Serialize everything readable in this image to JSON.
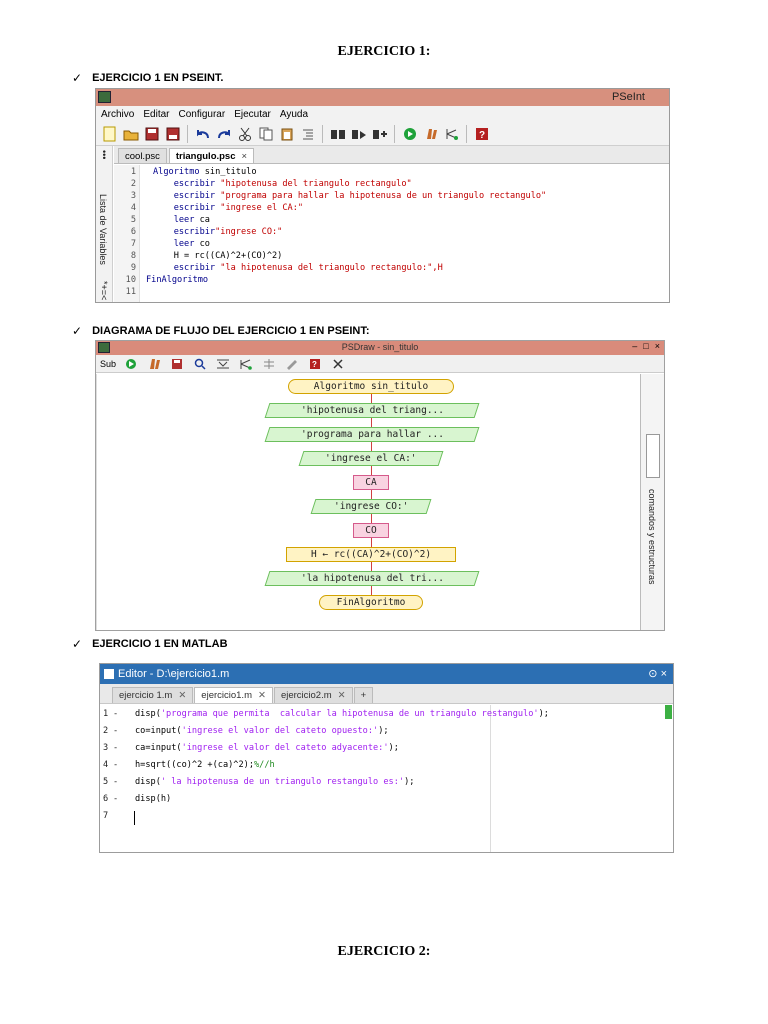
{
  "headings": {
    "ex1": "EJERCICIO 1:",
    "ex2": "EJERCICIO 2:"
  },
  "bullets": {
    "check_symbol": "✓",
    "b1": "EJERCICIO 1 EN PSEINT.",
    "b2": "DIAGRAMA DE FLUJO DEL EJERCICIO 1 EN PSEINT:",
    "b3": "EJERCICIO 1 EN MATLAB"
  },
  "pseint": {
    "title": "PSeInt",
    "menu": [
      "Archivo",
      "Editar",
      "Configurar",
      "Ejecutar",
      "Ayuda"
    ],
    "tabs": [
      {
        "label": "cool.psc",
        "active": false
      },
      {
        "label": "triangulo.psc",
        "active": true,
        "close": "×"
      }
    ],
    "side_label": "Lista de Variables",
    "side_ops_top": "•••",
    "side_ops_bottom": "*+=<",
    "lines": [
      {
        "n": "1",
        "kw": "Algoritmo",
        "rest": " sin_titulo"
      },
      {
        "n": "2",
        "kw": "    escribir",
        "rest": " \"hipotenusa del triangulo rectangulo\""
      },
      {
        "n": "3",
        "kw": "    escribir",
        "rest": " \"programa para hallar la hipotenusa de un triangulo rectangulo\""
      },
      {
        "n": "4",
        "kw": "    escribir",
        "rest": " \"ingrese el CA:\""
      },
      {
        "n": "5",
        "kw": "    leer",
        "rest": " ca"
      },
      {
        "n": "6",
        "kw": "    escribir",
        "rest": "\"ingrese CO:\""
      },
      {
        "n": "7",
        "kw": "    leer",
        "rest": " co"
      },
      {
        "n": "8",
        "kw": "    H = rc((CA)^2+(CO)^2)",
        "rest": ""
      },
      {
        "n": "9",
        "kw": "    escribir",
        "rest": " \"la hipotenusa del triangulo rectangulo:\",H"
      },
      {
        "n": "10",
        "kw": "FinAlgoritmo",
        "rest": ""
      },
      {
        "n": "11",
        "kw": "",
        "rest": ""
      }
    ]
  },
  "psdraw": {
    "title": "PSDraw - sin_titulo",
    "controls": [
      "–",
      "□",
      "×"
    ],
    "toolbar_label": "Sub",
    "side_label": "comandos y estructuras",
    "nodes": [
      {
        "kind": "term",
        "text": "Algoritmo sin_titulo"
      },
      {
        "kind": "io",
        "text": "'hipotenusa del triang..."
      },
      {
        "kind": "io",
        "text": "'programa para hallar ..."
      },
      {
        "kind": "io",
        "text": "'ingrese el CA:'"
      },
      {
        "kind": "in",
        "text": "CA"
      },
      {
        "kind": "io",
        "text": "'ingrese CO:'"
      },
      {
        "kind": "in",
        "text": "CO"
      },
      {
        "kind": "assign",
        "text": "H ← rc((CA)^2+(CO)^2)"
      },
      {
        "kind": "io",
        "text": "'la hipotenusa del tri..."
      },
      {
        "kind": "term",
        "text": "FinAlgoritmo"
      }
    ]
  },
  "matlab": {
    "title": "Editor - D:\\ejercicio1.m",
    "controls": "⊙ ×",
    "tabs": [
      {
        "label": "ejercicio 1.m",
        "active": false
      },
      {
        "label": "ejercicio1.m",
        "active": true
      },
      {
        "label": "ejercicio2.m",
        "active": false
      },
      {
        "label": "+",
        "active": false
      }
    ],
    "lines": [
      {
        "n": "1",
        "pre": "disp(",
        "str": "'programa que permita  calcular la hipotenusa de un triangulo restangulo'",
        "post": ");",
        "com": ""
      },
      {
        "n": "2",
        "pre": "co=input(",
        "str": "'ingrese el valor del cateto opuesto:'",
        "post": ");",
        "com": ""
      },
      {
        "n": "3",
        "pre": "ca=input(",
        "str": "'ingrese el valor del cateto adyacente:'",
        "post": ");",
        "com": ""
      },
      {
        "n": "4",
        "pre": "h=sqrt((co)^2 +(ca)^2);",
        "str": "",
        "post": "",
        "com": "%//h"
      },
      {
        "n": "5",
        "pre": "disp(",
        "str": "' la hipotenusa de un triangulo restangulo es:'",
        "post": ");",
        "com": ""
      },
      {
        "n": "6",
        "pre": "disp(h)",
        "str": "",
        "post": "",
        "com": ""
      },
      {
        "n": "7",
        "pre": "",
        "str": "",
        "post": "",
        "com": ""
      }
    ]
  }
}
